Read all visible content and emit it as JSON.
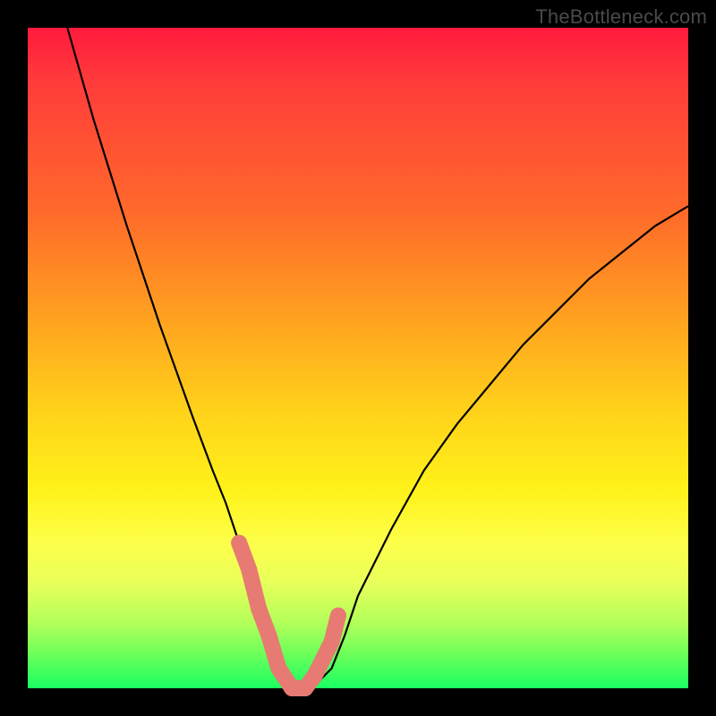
{
  "watermark": "TheBottleneck.com",
  "colors": {
    "frame": "#000000",
    "gradient_top": "#ff1a3d",
    "gradient_bottom": "#1aff62",
    "curve": "#000000",
    "marker": "#e77a73"
  },
  "chart_data": {
    "type": "line",
    "title": "",
    "xlabel": "",
    "ylabel": "",
    "xlim": [
      0,
      100
    ],
    "ylim": [
      0,
      100
    ],
    "x": [
      6,
      10,
      15,
      20,
      25,
      28,
      30,
      32,
      34,
      35,
      36,
      37,
      38,
      39,
      40,
      41,
      42,
      43,
      44,
      46,
      48,
      50,
      55,
      60,
      65,
      70,
      75,
      80,
      85,
      90,
      95,
      100
    ],
    "values": [
      100,
      86,
      70,
      55,
      41,
      33,
      28,
      22,
      16,
      12,
      8,
      5,
      3,
      1,
      0,
      0,
      0,
      0,
      1,
      3,
      8,
      14,
      24,
      33,
      40,
      46,
      52,
      57,
      62,
      66,
      70,
      73
    ],
    "markers": {
      "x": [
        32,
        33.5,
        35,
        36.5,
        38,
        40,
        42,
        43.5,
        45,
        46,
        47
      ],
      "values": [
        22,
        18,
        12,
        8,
        3,
        0,
        0,
        2,
        5,
        7,
        11
      ]
    },
    "annotations": []
  }
}
